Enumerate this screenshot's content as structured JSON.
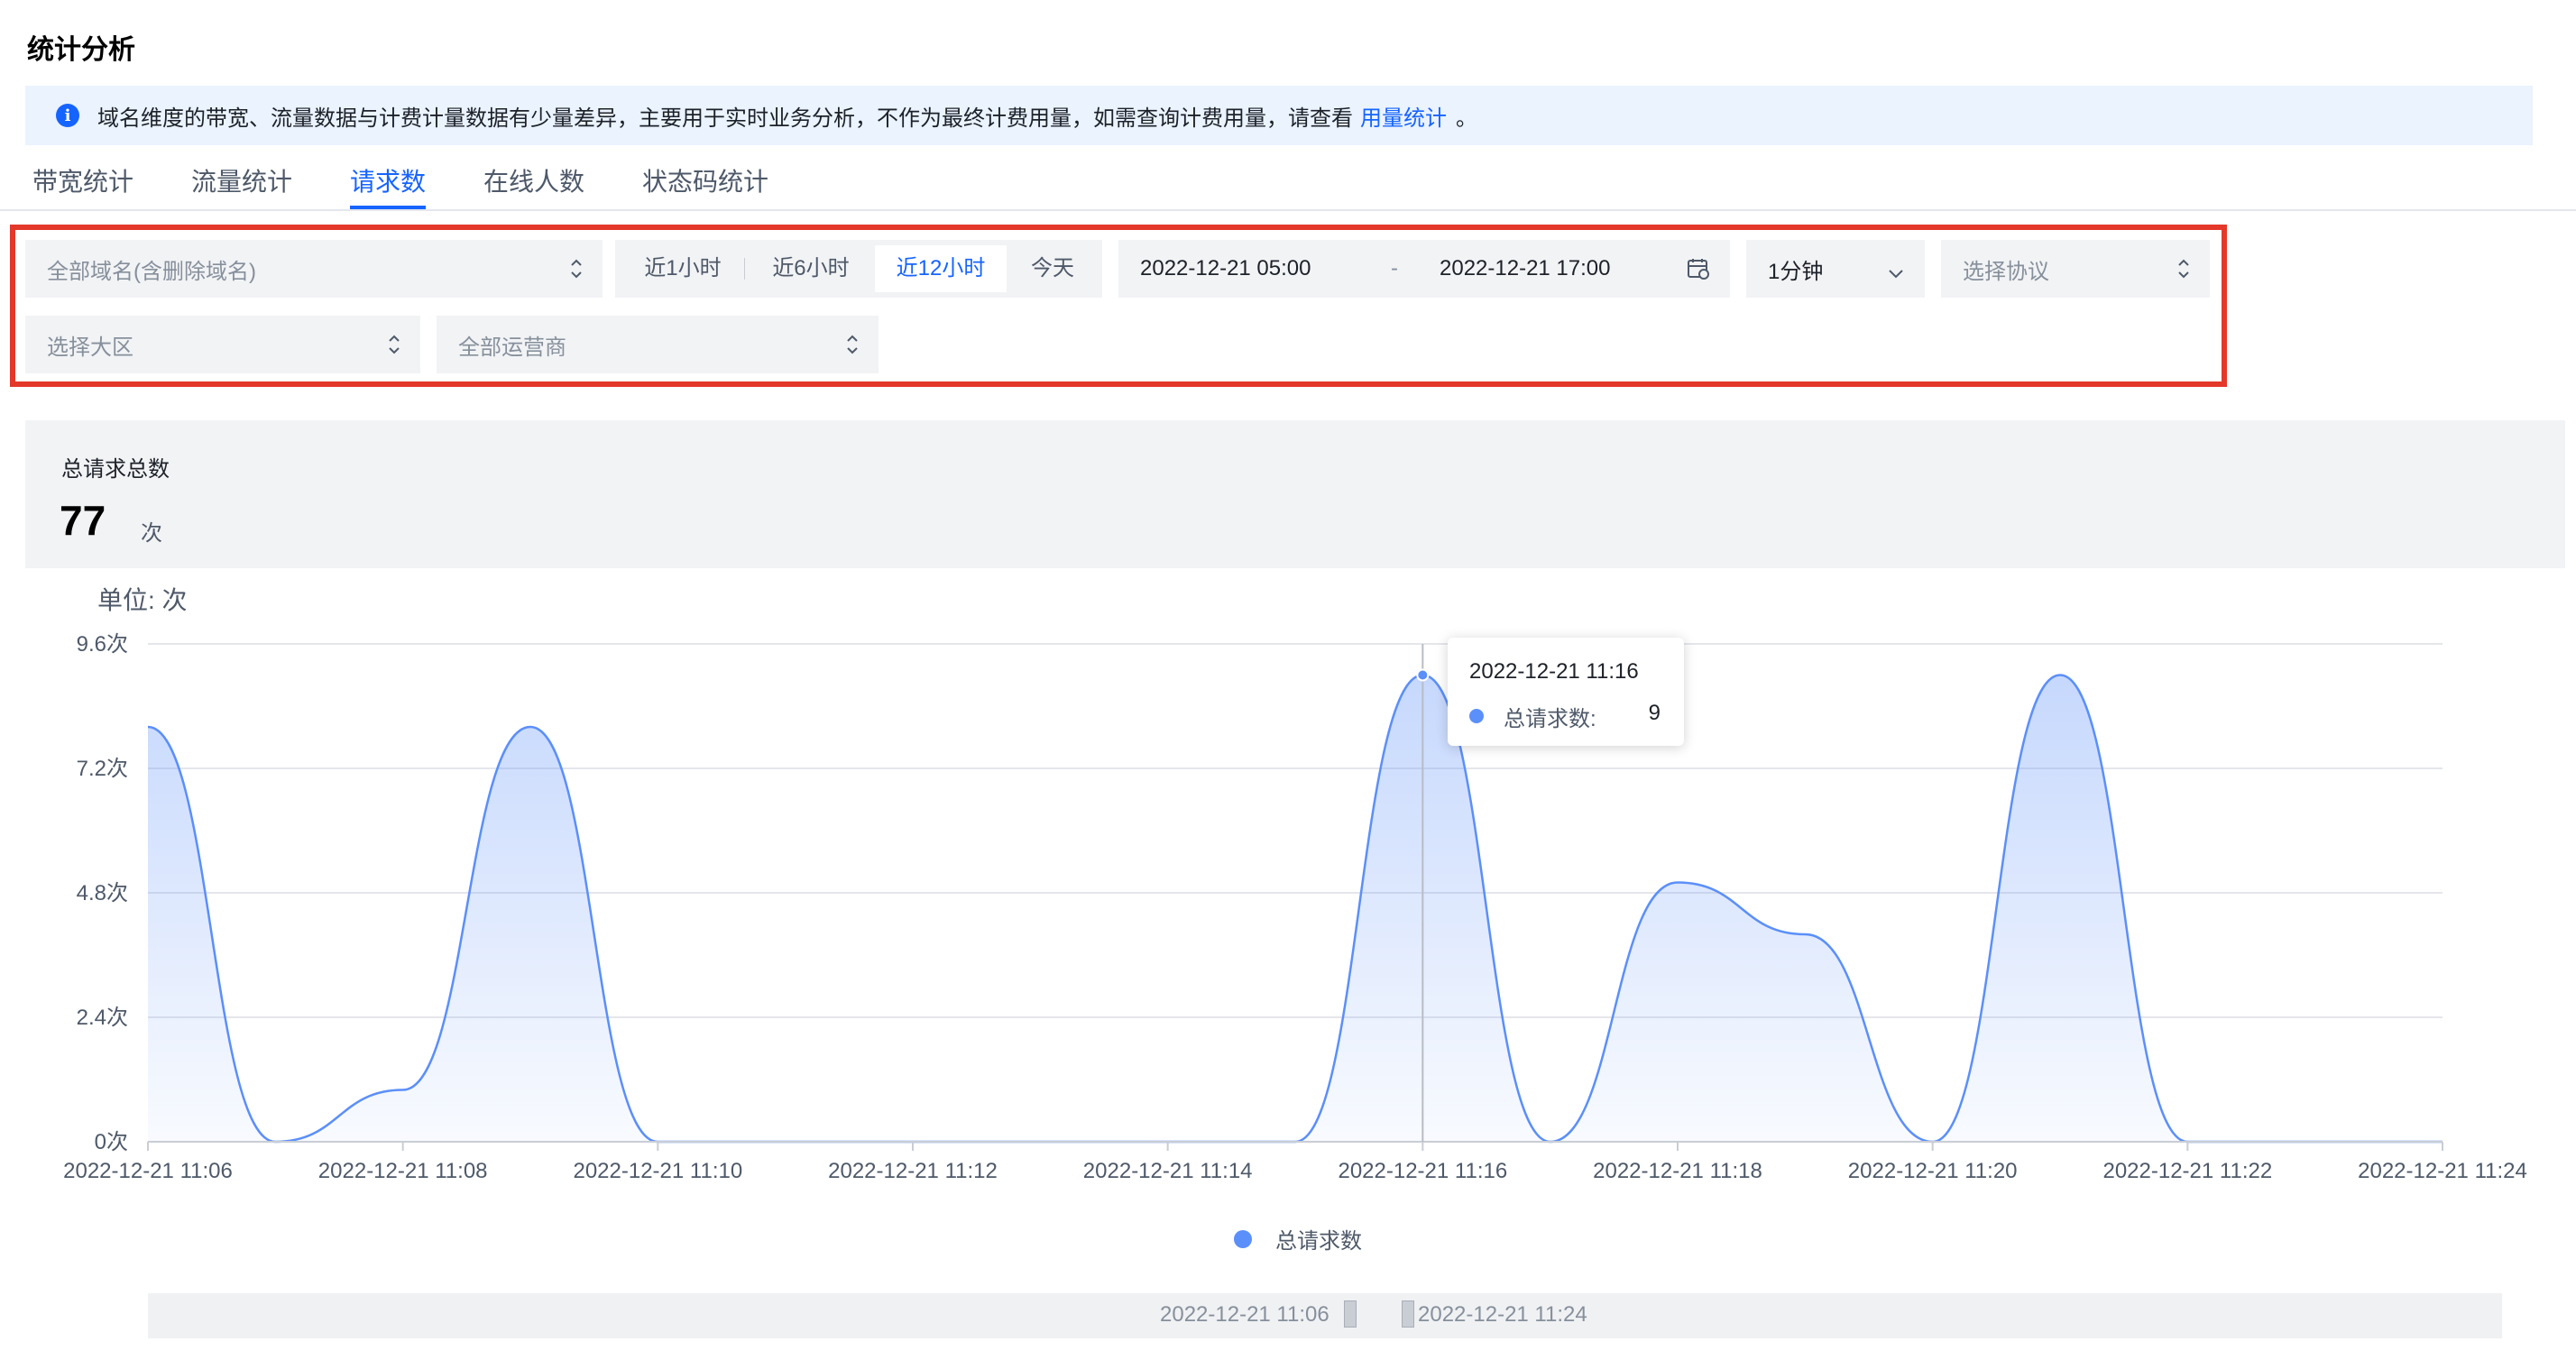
{
  "page": {
    "title": "统计分析"
  },
  "banner": {
    "text": "域名维度的带宽、流量数据与计费计量数据有少量差异，主要用于实时业务分析，不作为最终计费用量，如需查询计费用量，请查看",
    "link": "用量统计",
    "suffix": "。"
  },
  "tabs": [
    {
      "label": "带宽统计",
      "active": false
    },
    {
      "label": "流量统计",
      "active": false
    },
    {
      "label": "请求数",
      "active": true
    },
    {
      "label": "在线人数",
      "active": false
    },
    {
      "label": "状态码统计",
      "active": false
    }
  ],
  "filters": {
    "domain_placeholder": "全部域名(含删除域名)",
    "time_ranges": [
      "近1小时",
      "近6小时",
      "近12小时",
      "今天"
    ],
    "active_range": "近12小时",
    "date_start": "2022-12-21 05:00",
    "date_sep": "-",
    "date_end": "2022-12-21 17:00",
    "granularity": "1分钟",
    "protocol_placeholder": "选择协议",
    "region_placeholder": "选择大区",
    "isp_placeholder": "全部运营商"
  },
  "summary": {
    "label": "总请求总数",
    "value": "77",
    "unit": "次"
  },
  "chart_unit_label": "单位: 次",
  "tooltip": {
    "time": "2022-12-21 11:16",
    "series": "总请求数:",
    "value": "9"
  },
  "slider": {
    "start_label": "2022-12-21 11:06",
    "end_label": "2022-12-21 11:24"
  },
  "colors": {
    "accent": "#1664ff",
    "series": "#5b8ff9",
    "highlight_border": "#e3382a"
  },
  "chart_data": {
    "type": "area",
    "xlabel": "",
    "ylabel": "单位: 次",
    "ylim": [
      0,
      9.6
    ],
    "y_ticks": [
      "0次",
      "2.4次",
      "4.8次",
      "7.2次",
      "9.6次"
    ],
    "x_ticks": [
      "2022-12-21 11:06",
      "2022-12-21 11:08",
      "2022-12-21 11:10",
      "2022-12-21 11:12",
      "2022-12-21 11:14",
      "2022-12-21 11:16",
      "2022-12-21 11:18",
      "2022-12-21 11:20",
      "2022-12-21 11:22",
      "2022-12-21 11:24"
    ],
    "grid": true,
    "legend_position": "bottom",
    "series": [
      {
        "name": "总请求数",
        "x": [
          "11:06",
          "11:07",
          "11:08",
          "11:09",
          "11:10",
          "11:11",
          "11:12",
          "11:13",
          "11:14",
          "11:15",
          "11:16",
          "11:17",
          "11:18",
          "11:19",
          "11:20",
          "11:21",
          "11:22",
          "11:23",
          "11:24"
        ],
        "values": [
          8,
          0,
          1,
          8,
          0,
          0,
          0,
          0,
          0,
          0,
          9,
          0,
          5,
          4,
          0,
          9,
          0,
          0,
          0
        ]
      }
    ]
  }
}
